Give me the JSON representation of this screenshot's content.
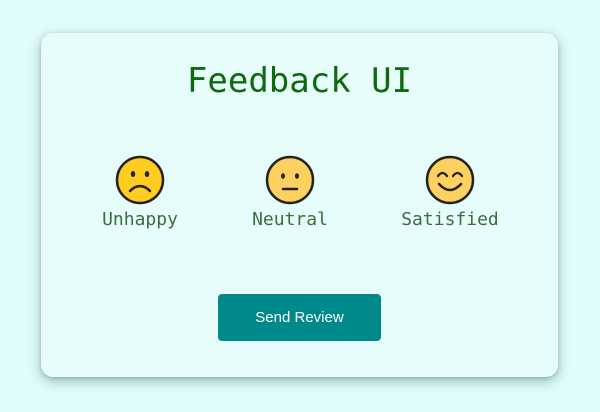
{
  "title": "Feedback UI",
  "ratings": [
    {
      "label": "Unhappy",
      "icon": "sad-face-icon"
    },
    {
      "label": "Neutral",
      "icon": "neutral-face-icon"
    },
    {
      "label": "Satisfied",
      "icon": "smiling-face-icon"
    }
  ],
  "send_button": {
    "label": "Send Review"
  },
  "colors": {
    "page_background": "#e0fcfb",
    "card_background": "#e6fdfc",
    "title": "#0d6a0d",
    "label": "#3d6e3d",
    "button": "#00898a",
    "button_text": "#ffffff",
    "face_fill": "#ffcc22",
    "face_fill_muted": "#fdd060"
  }
}
